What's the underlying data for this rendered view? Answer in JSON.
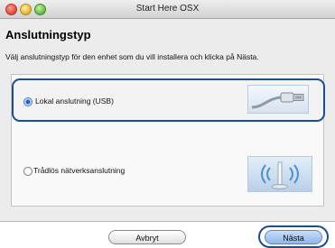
{
  "window": {
    "title": "Start Here OSX"
  },
  "page": {
    "heading": "Anslutningstyp",
    "instruction": "Välj anslutningstyp för den enhet som du vill installera och klicka på Nästa."
  },
  "options": [
    {
      "label": "Lokal anslutning (USB)",
      "selected": true,
      "icon": "usb-cable-icon"
    },
    {
      "label": "Trådlös nätverksanslutning",
      "selected": false,
      "icon": "wireless-antenna-icon"
    }
  ],
  "buttons": {
    "cancel": "Avbryt",
    "next": "Nästa"
  },
  "colors": {
    "highlight": "#1e4d8f",
    "default_button": "#8fb6ea"
  }
}
